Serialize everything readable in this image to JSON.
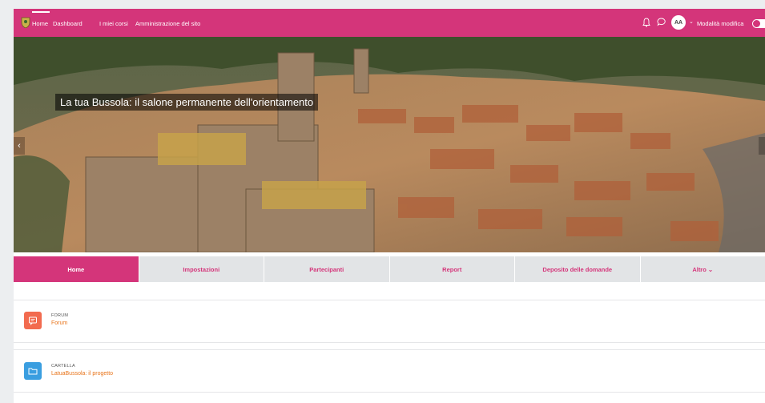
{
  "navbar": {
    "items": [
      "Home",
      "Dashboard",
      "I miei corsi",
      "Amministrazione del sito"
    ],
    "avatar_initials": "AA",
    "edit_mode_label": "Modalità modifica",
    "color": "#d4357a"
  },
  "hero": {
    "title": "La tua Bussola: il salone permanente dell'orientamento"
  },
  "tabs": [
    "Home",
    "Impostazioni",
    "Partecipanti",
    "Report",
    "Deposito delle domande",
    "Altro ⌄"
  ],
  "activities": [
    {
      "type": "FORUM",
      "name": "Forum",
      "icon": "forum-icon",
      "color": "#f26b4f"
    },
    {
      "type": "CARTELLA",
      "name": "LatuaBussola: il progetto",
      "icon": "folder-icon",
      "color": "#3a9ee0"
    }
  ]
}
